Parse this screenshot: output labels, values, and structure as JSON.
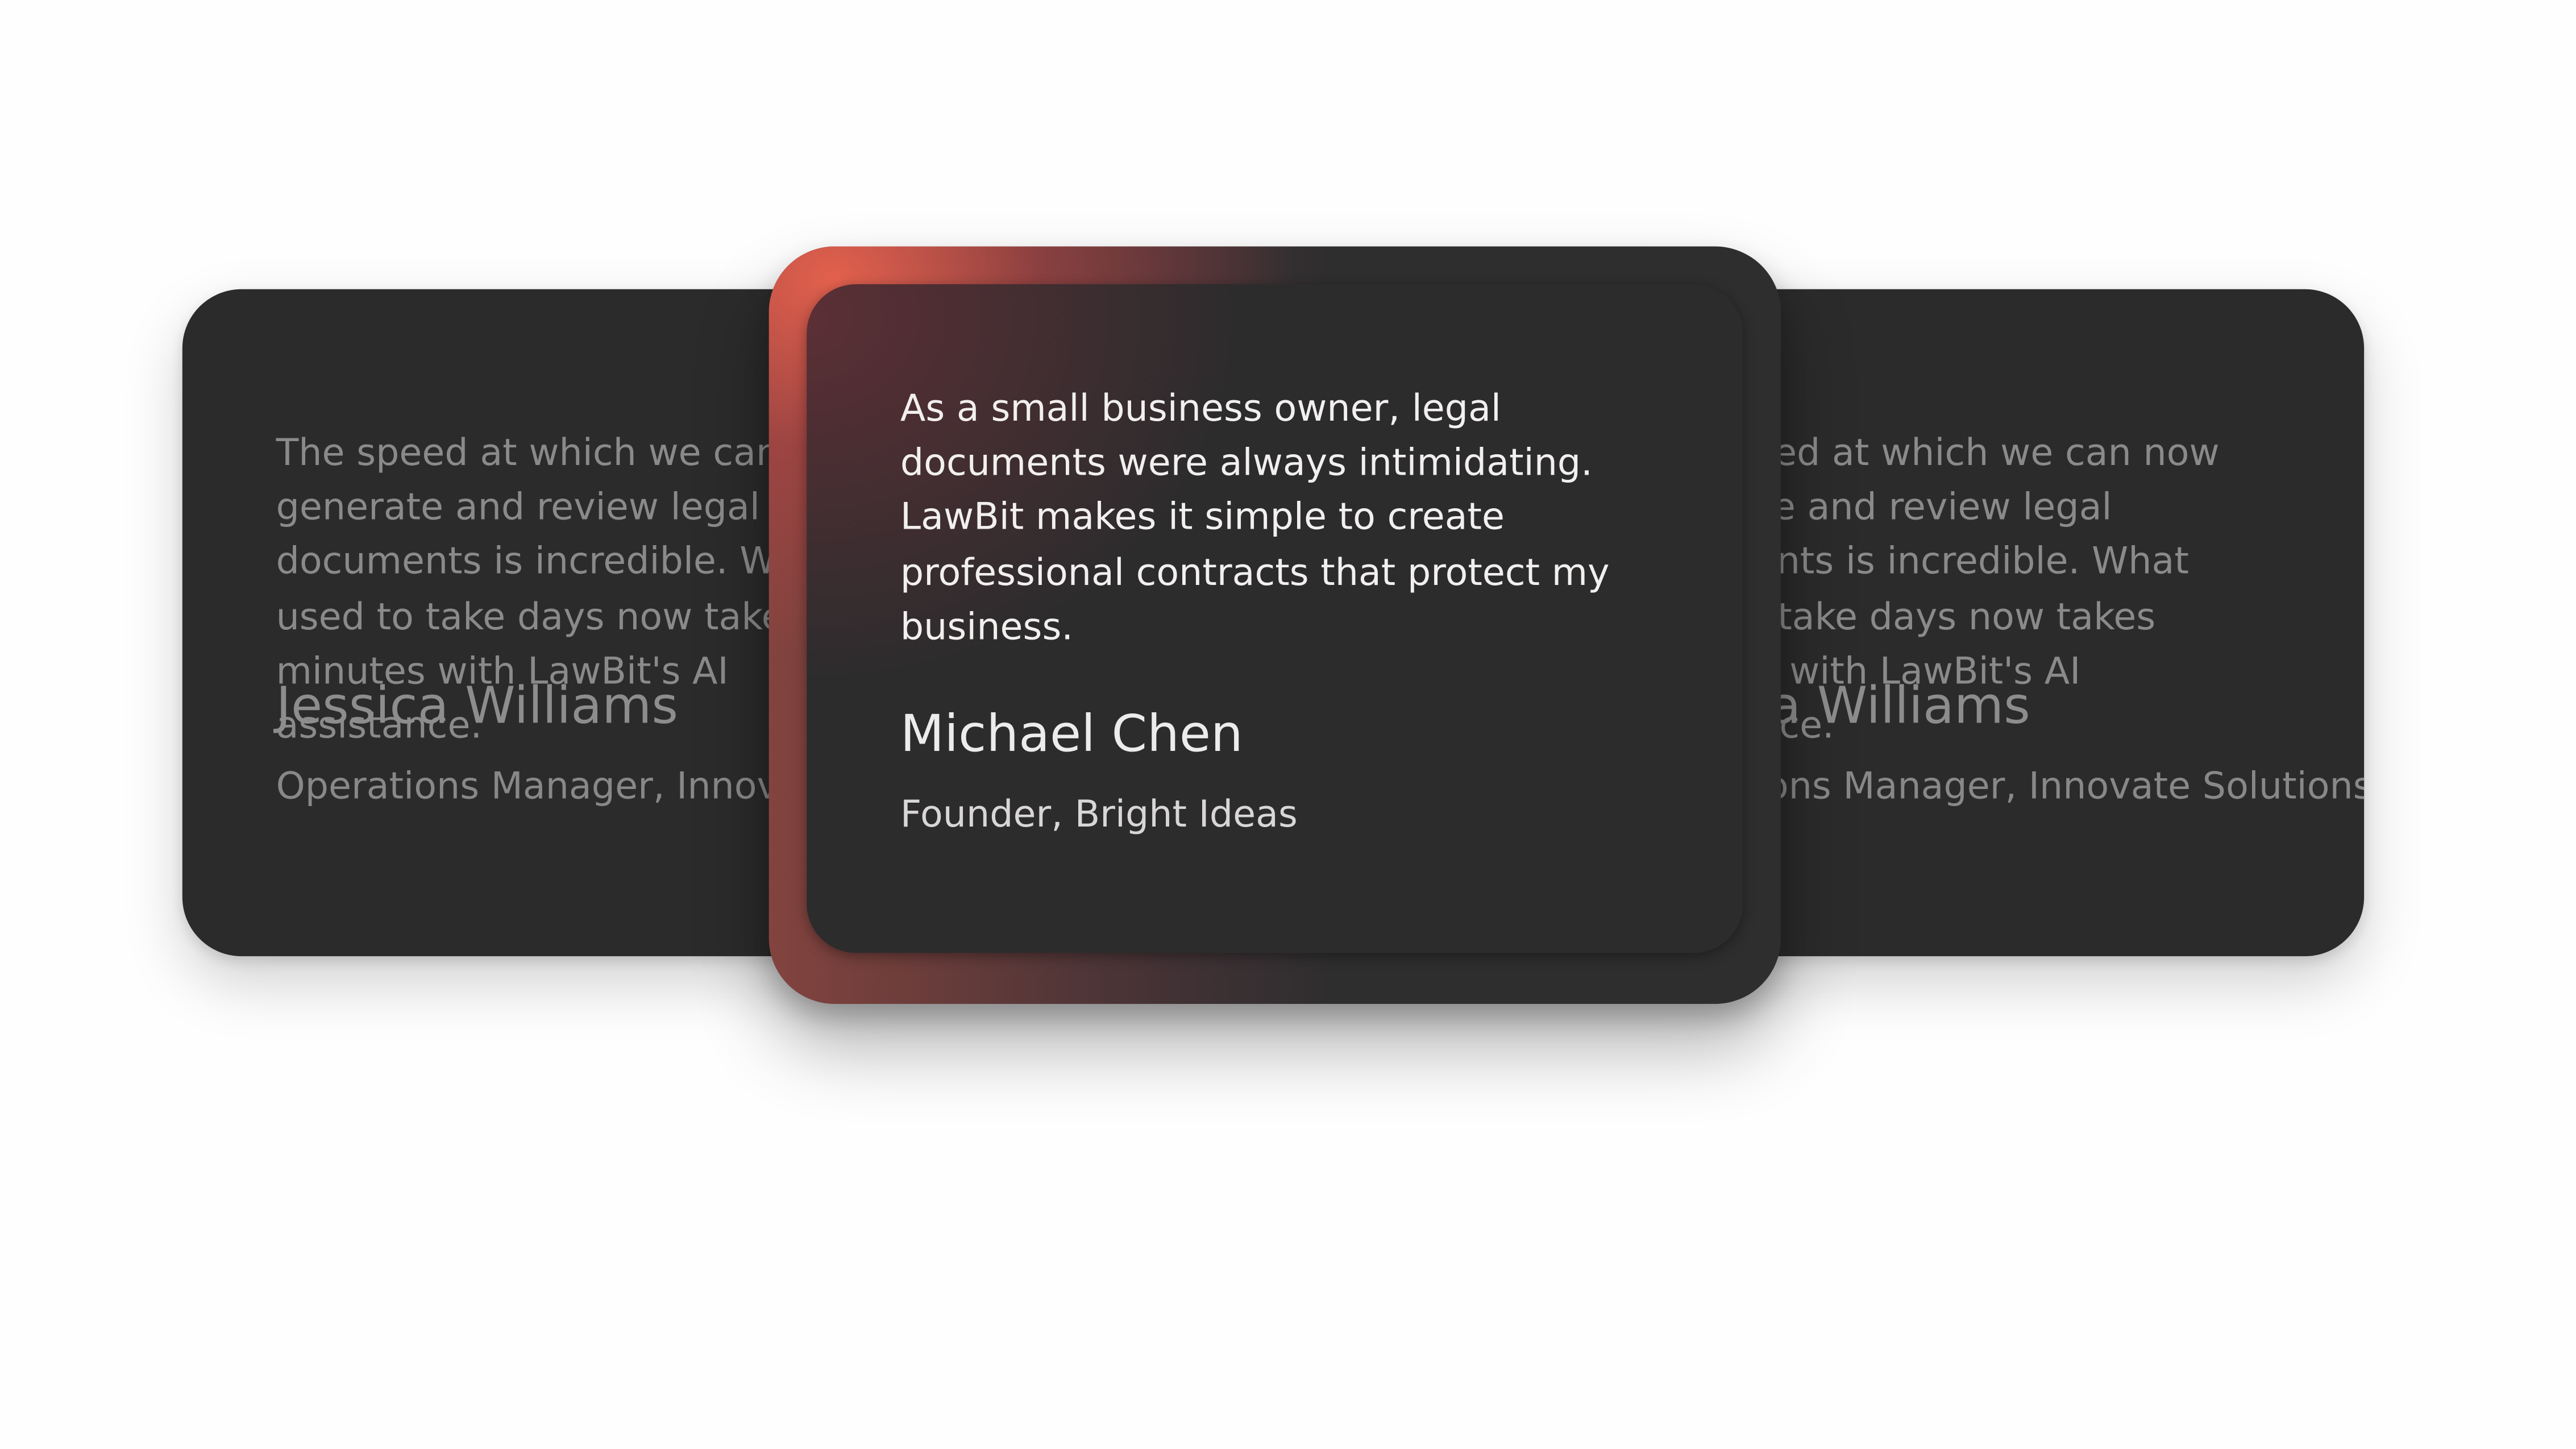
{
  "testimonials": [
    {
      "quote": "The speed at which we can now generate and review legal documents is incredible. What used to take days now takes minutes with LawBit's AI assistance.",
      "name": "Jessica Williams",
      "role": "Operations Manager, Innovate Solutions"
    },
    {
      "quote": "As a small business owner, legal documents were always intimidating. LawBit makes it simple to create professional contracts that protect my business.",
      "name": "Michael Chen",
      "role": "Founder, Bright Ideas"
    }
  ],
  "colors": {
    "page_background": "#fefefe",
    "card_background": "#2b2b2b",
    "accent_glow": "#e8624e"
  }
}
